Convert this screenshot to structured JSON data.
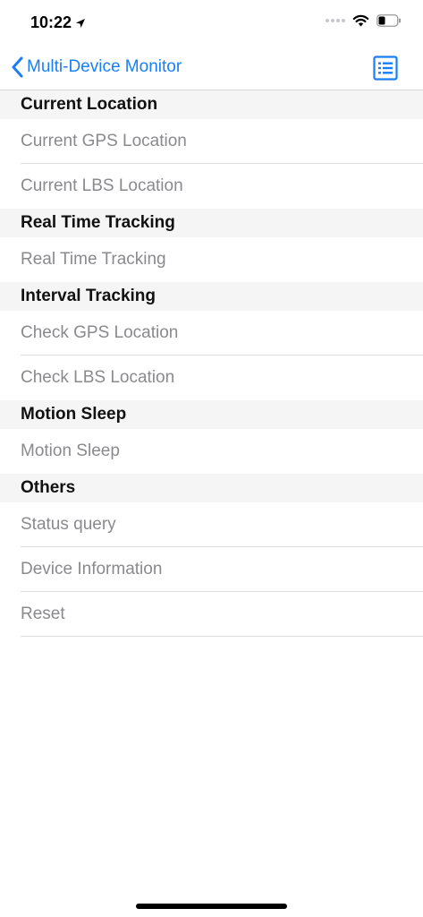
{
  "status_bar": {
    "time": "10:22"
  },
  "nav": {
    "back_label": "Multi-Device Monitor",
    "accent_color": "#1a7ef6"
  },
  "sections": [
    {
      "title": "Current Location",
      "items": [
        "Current GPS Location",
        "Current LBS Location"
      ]
    },
    {
      "title": "Real Time Tracking",
      "items": [
        "Real Time Tracking"
      ]
    },
    {
      "title": "Interval Tracking",
      "items": [
        "Check GPS Location",
        "Check LBS Location"
      ]
    },
    {
      "title": "Motion Sleep",
      "items": [
        "Motion Sleep"
      ]
    },
    {
      "title": "Others",
      "items": [
        "Status query",
        "Device Information",
        "Reset"
      ]
    }
  ]
}
